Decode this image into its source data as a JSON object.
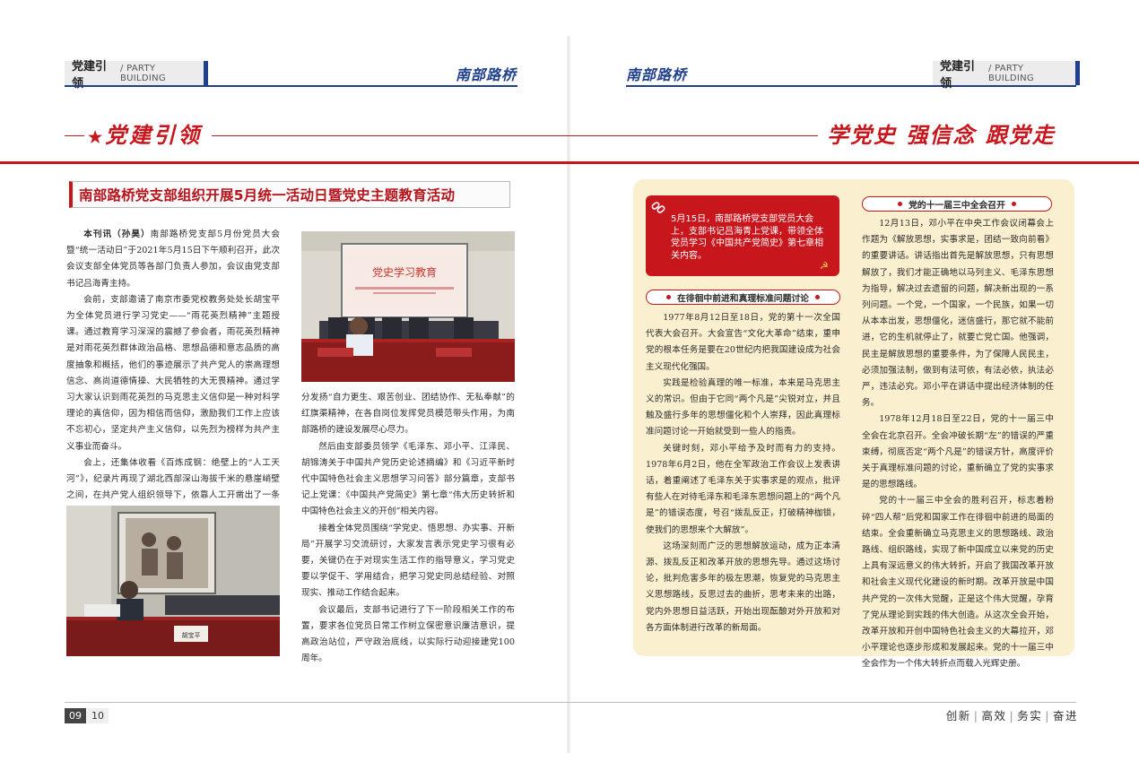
{
  "header": {
    "section_cn": "党建引领",
    "section_en": "/ PARTY BUILDING",
    "brand": "南部路桥"
  },
  "section_title_left": "党建引领",
  "section_title_right": "学党史 强信念 跟党走",
  "article": {
    "title": "南部路桥党支部组织开展5月统一活动日暨党史主题教育活动",
    "col1_lead": "本刊讯（孙昊）",
    "col1_p1": "南部路桥党支部5月份党员大会暨“统一活动日”于2021年5月15日下午顺利召开，此次会议支部全体党员等各部门负责人参加，会议由党支部书记吕海青主持。",
    "col1_p2": "会前，支部邀请了南京市委党校教务处处长胡宝平为全体党员进行学习党史——“雨花英烈精神”主题授课。通过教育学习深深的震撼了参会者，雨花英烈精神是对雨花英烈群体政治品格、思想品德和意志品质的高度抽象和概括，他们的事迹展示了共产党人的崇高理想信念、高尚道德情操、大民牺牲的大无畏精神。通过学习大家认识到雨花英烈的马克思主义信仰是一种对科学理论的真信仰，因为相信而信仰，激励我们工作上应该不忘初心，坚定共产主义信仰，以先烈为榜样为共产主义事业而奋斗。",
    "col1_p3": "会上，还集体收看《百炼成钢：绝壁上的“人工天河”》，纪录片再现了湖北西部深山海拔千米的悬崖峭壁之间，在共产党人组织领导下，依靠人工开凿出了一条蜿蜒数十公里的“红旗渠”。吕书记指出在日常工作中要充",
    "col2_p1": "分发扬“自力更生、艰苦创业、团结协作、无私奉献”的红旗渠精神，在各自岗位发挥党员模范带头作用，为南部路桥的建设发展尽心尽力。",
    "col2_p2": "然后由支部委员领学《毛泽东、邓小平、江泽民、胡锦涛关于中国共产党历史论述摘编》和《习近平新时代中国特色社会主义思想学习问答》部分篇章，支部书记上党课：《中国共产党简史》第七章“伟大历史转折和中国特色社会主义的开创”相关内容。",
    "col2_p3": "接着全体党员围绕“学党史、悟思想、办实事、开新局”开展学习交流研讨，大家发言表示党史学习很有必要，关键仍在于对现实生活工作的指导意义，学习党史要以学促干、学用结合，把学习党史同总结经验、对照现实、推动工作结合起来。",
    "col2_p4": "会议最后，支部书记进行了下一阶段相关工作的布置，要求各位党员日常工作树立保密意识廉洁意识，提高政治站位，严守政治底线，以实际行动迎接建党100周年。",
    "screen_text": "党史学习教育",
    "nameplate": "胡宝平"
  },
  "notice": "5月15日，南部路桥党支部党员大会上，支部书记吕海青上党课，带领全体党员学习《中国共产党简史》第七章相关内容。",
  "subsection1": {
    "title": "在徘徊中前进和真理标准问题讨论",
    "p1": "1977年8月12日至18日，党的第十一次全国代表大会召开。大会宣告“文化大革命”结束，重申党的根本任务是要在20世纪内把我国建设成为社会主义现代化强国。",
    "p2": "实践是检验真理的唯一标准，本来是马克思主义的常识。但由于它同“两个凡是”尖锐对立，并且触及盛行多年的思想僵化和个人崇拜，因此真理标准问题讨论一开始就受到一些人的指责。",
    "p3": "关键时刻，邓小平给予及时而有力的支持。1978年6月2日，他在全军政治工作会议上发表讲话，着重阐述了毛泽东关于实事求是的观点，批评有些人在对待毛泽东和毛泽东思想问题上的“两个凡是”的错误态度，号召“拨乱反正，打破精神枷锁，使我们的思想来个大解放”。",
    "p4": "这场深刻而广泛的思想解放运动，成为正本清源、拨乱反正和改革开放的思想先导。通过这场讨论，批判危害多年的极左思潮，恢复党的马克思主义思想路线，反思过去的曲折，思考未来的出路，党内外思想日益活跃，开始出现酝酿对外开放和对各方面体制进行改革的新局面。"
  },
  "subsection2": {
    "title": "党的十一届三中全会召开",
    "p1": "12月13日，邓小平在中央工作会议闭幕会上作题为《解放思想，实事求是，团结一致向前看》的重要讲话。讲话指出首先是解放思想，只有思想解放了，我们才能正确地以马列主义、毛泽东思想为指导，解决过去遗留的问题，解决新出现的一系列问题。一个党，一个国家，一个民族，如果一切从本本出发，思想僵化，迷信盛行，那它就不能前进，它的生机就停止了，就要亡党亡国。他强调，民主是解放思想的重要条件，为了保障人民民主，必须加强法制，做到有法可依，有法必依，执法必严，违法必究。邓小平在讲话中提出经济体制的任务。",
    "p2": "1978年12月18日至22日，党的十一届三中全会在北京召开。全会冲破长期“左”的错误的严重束缚，彻底否定“两个凡是”的错误方针，高度评价关于真理标准问题的讨论，重新确立了党的实事求是的思想路线。",
    "p3": "党的十一届三中全会的胜利召开，标志着粉碎“四人帮”后党和国家工作在徘徊中前进的局面的结束。全会重新确立马克思主义的思想路线、政治路线、组织路线，实现了新中国成立以来党的历史上具有深远意义的伟大转折，开启了我国改革开放和社会主义现代化建设的新时期。改革开放是中国共产党的一次伟大觉醒，正是这个伟大觉醒，孕育了党从理论到实践的伟大创造。从这次全会开始，改革开放和开创中国特色社会主义的大幕拉开，邓小平理论也逐步形成和发展起来。党的十一届三中全会作为一个伟大转折点而载入光辉史册。"
  },
  "footer": {
    "page_left": "09",
    "page_right": "10",
    "motto": [
      "创新",
      "高效",
      "务实",
      "奋进"
    ]
  }
}
